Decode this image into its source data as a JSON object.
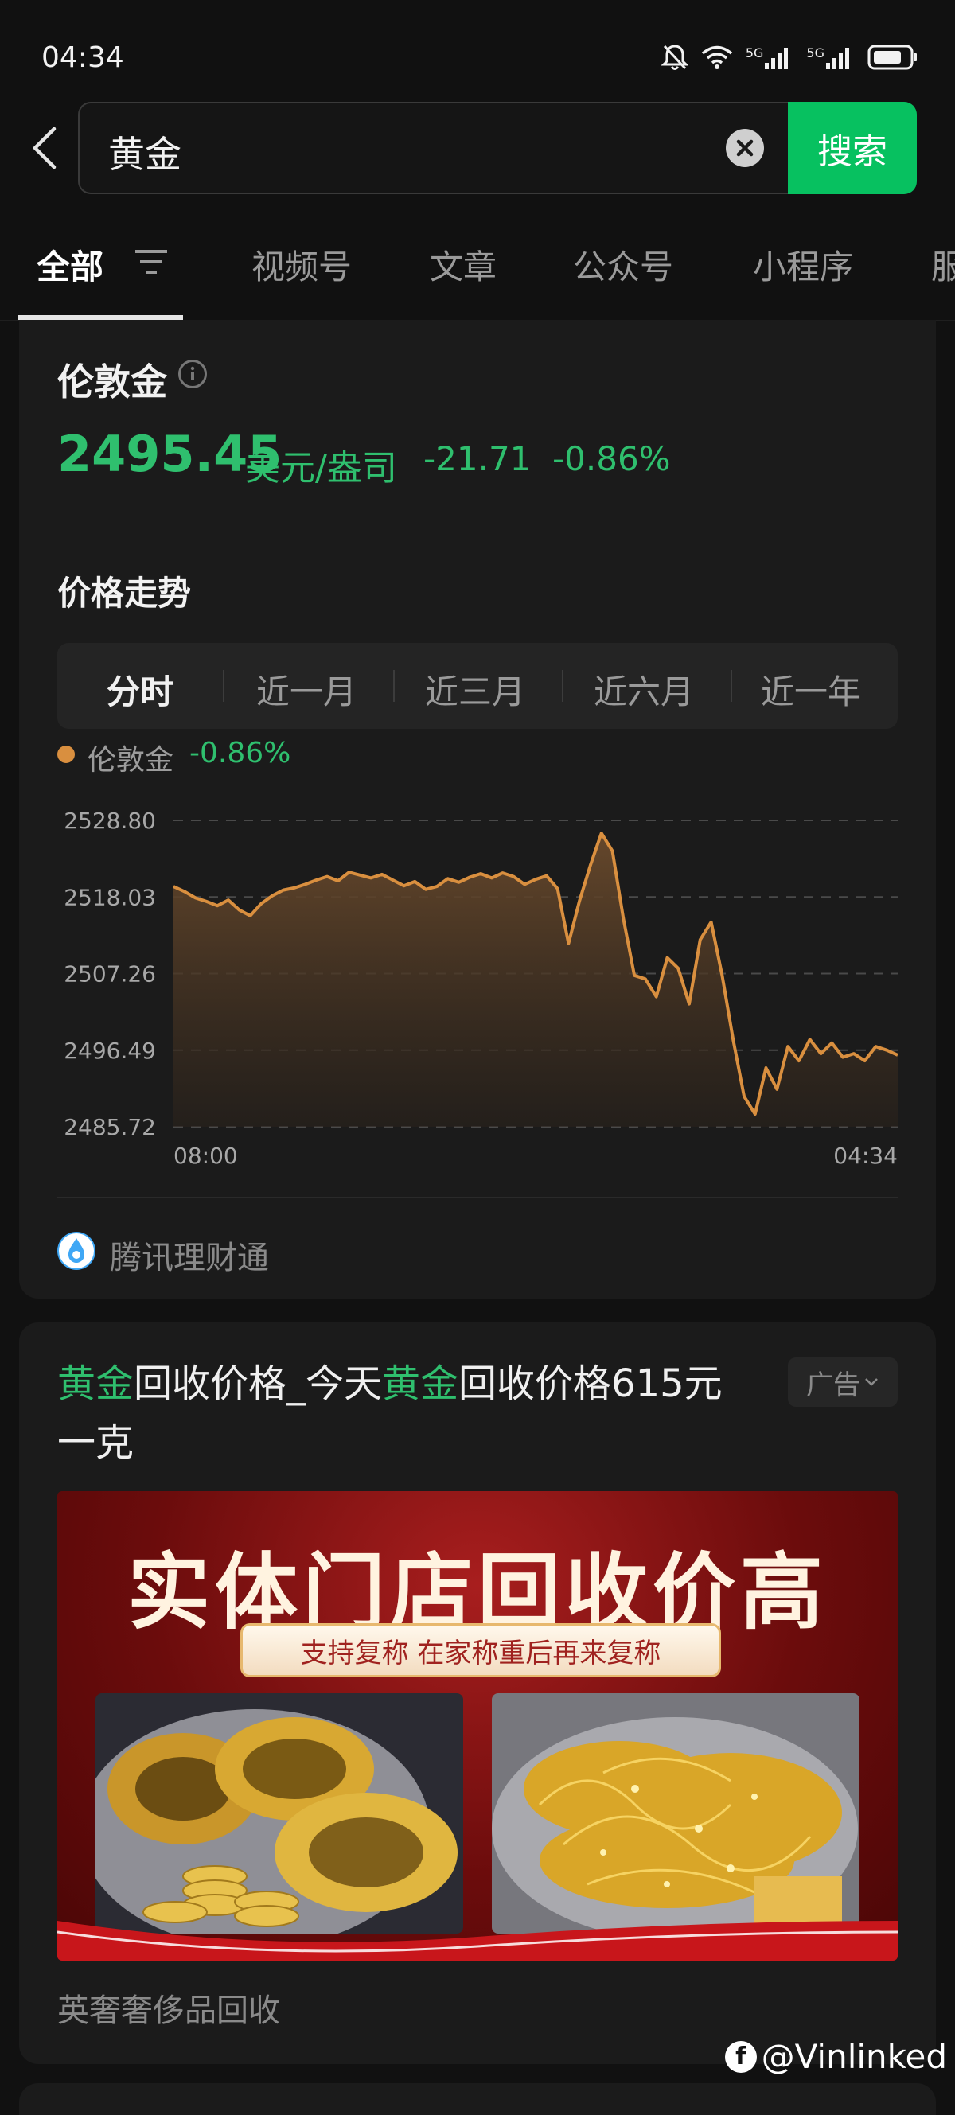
{
  "status_bar": {
    "time": "04:34",
    "icons": [
      "bell-off-icon",
      "wifi-icon",
      "signal-5g-icon",
      "signal-5g-icon",
      "battery-icon"
    ],
    "signal_label_1": "5G",
    "signal_label_2": "5G"
  },
  "search": {
    "query": "黄金",
    "button_label": "搜索"
  },
  "tabs": {
    "all": "全部",
    "video": "视频号",
    "articles": "文章",
    "official": "公众号",
    "mini": "小程序",
    "more": "服"
  },
  "gold_card": {
    "name": "伦敦金",
    "price": "2495.45",
    "unit": "美元/盎司",
    "change": "-21.71",
    "change_pct": "-0.86%",
    "trend_title": "价格走势",
    "ranges": [
      "分时",
      "近一月",
      "近三月",
      "近六月",
      "近一年"
    ],
    "active_range": "分时",
    "legend_name": "伦敦金",
    "legend_pct": "-0.86%",
    "source": "腾讯理财通"
  },
  "chart_data": {
    "type": "area",
    "series": [
      {
        "name": "伦敦金",
        "color": "#d98f3f",
        "values": [
          2519.5,
          2518.8,
          2517.9,
          2517.4,
          2516.8,
          2517.6,
          2516.2,
          2515.4,
          2517.1,
          2518.2,
          2519.0,
          2519.3,
          2519.8,
          2520.4,
          2520.9,
          2520.3,
          2521.5,
          2521.1,
          2520.7,
          2521.2,
          2520.4,
          2519.6,
          2520.2,
          2519.1,
          2519.5,
          2520.6,
          2520.1,
          2520.8,
          2521.3,
          2520.7,
          2521.4,
          2520.9,
          2519.8,
          2520.5,
          2521.0,
          2519.2,
          2511.5,
          2517.5,
          2522.5,
          2527.0,
          2524.5,
          2515.0,
          2507.0,
          2506.5,
          2504.0,
          2509.5,
          2508.0,
          2503.0,
          2512.0,
          2514.5,
          2507.0,
          2498.0,
          2490.0,
          2487.5,
          2494.0,
          2491.0,
          2497.0,
          2495.0,
          2498.0,
          2496.0,
          2497.5,
          2495.5,
          2496.0,
          2495.0,
          2497.0,
          2496.5,
          2495.8
        ]
      }
    ],
    "x_labels": [
      "08:00",
      "04:34"
    ],
    "y_ticks": [
      2528.8,
      2518.03,
      2507.26,
      2496.49,
      2485.72
    ],
    "y_tick_labels": [
      "2528.80",
      "2518.03",
      "2507.26",
      "2496.49",
      "2485.72"
    ],
    "ylim": [
      2485.72,
      2528.8
    ],
    "grid": "dashed-horizontal",
    "fill": true
  },
  "ad_card": {
    "title_hl_1": "黄金",
    "title_mid_1": "回收价格_今天",
    "title_hl_2": "黄金",
    "title_tail": "回收价格615元一克",
    "badge": "广告",
    "image_headline": "实体门店回收价高",
    "image_subbanner": "支持复称 在家称重后再来复称",
    "advertiser": "英奢奢侈品回收"
  },
  "watermark": {
    "text": "@Vinlinked",
    "logo": "f"
  }
}
